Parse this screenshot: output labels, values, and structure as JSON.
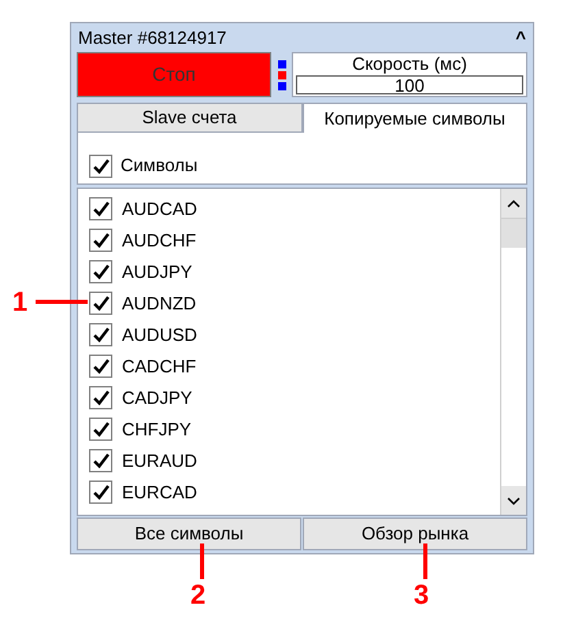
{
  "panel": {
    "title": "Master #68124917",
    "collapse_glyph": "^"
  },
  "stop_button": {
    "label": "Стоп"
  },
  "indicators": [
    {
      "color": "#0000ff"
    },
    {
      "color": "#ff0000"
    },
    {
      "color": "#0000ff"
    }
  ],
  "speed": {
    "label": "Скорость (мс)",
    "value": "100"
  },
  "tabs": [
    {
      "label": "Slave счета",
      "selected": false
    },
    {
      "label": "Копируемые символы",
      "selected": true
    }
  ],
  "symbols_toggle": {
    "label": "Символы",
    "checked": true
  },
  "symbols": [
    {
      "label": "AUDCAD",
      "checked": true
    },
    {
      "label": "AUDCHF",
      "checked": true
    },
    {
      "label": "AUDJPY",
      "checked": true
    },
    {
      "label": "AUDNZD",
      "checked": true
    },
    {
      "label": "AUDUSD",
      "checked": true
    },
    {
      "label": "CADCHF",
      "checked": true
    },
    {
      "label": "CADJPY",
      "checked": true
    },
    {
      "label": "CHFJPY",
      "checked": true
    },
    {
      "label": "EURAUD",
      "checked": true
    },
    {
      "label": "EURCAD",
      "checked": true
    }
  ],
  "buttons": [
    "Все символы",
    "Обзор рынка"
  ],
  "callouts": [
    {
      "label": "1",
      "kind": "horizontal"
    },
    {
      "label": "2",
      "kind": "vertical"
    },
    {
      "label": "3",
      "kind": "vertical"
    }
  ]
}
